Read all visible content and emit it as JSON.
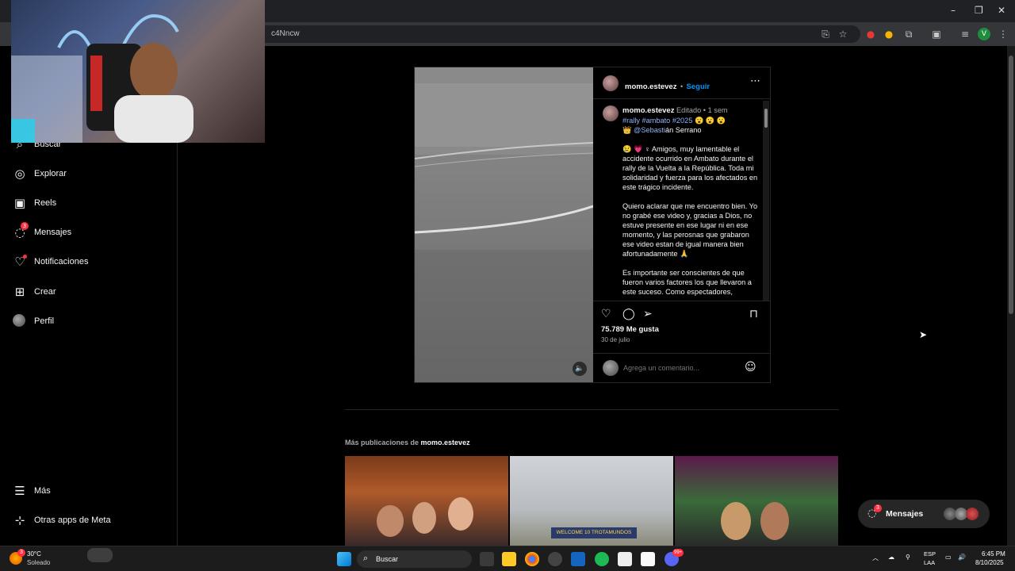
{
  "browser": {
    "url_fragment": "c4Nncw",
    "window_controls": [
      "–",
      "❐",
      "✕"
    ]
  },
  "sidebar": {
    "items": [
      {
        "label": "Buscar",
        "icon": "search-icon"
      },
      {
        "label": "Explorar",
        "icon": "compass-icon"
      },
      {
        "label": "Reels",
        "icon": "reels-icon"
      },
      {
        "label": "Mensajes",
        "icon": "messenger-icon",
        "badge": "3"
      },
      {
        "label": "Notificaciones",
        "icon": "heart-icon"
      },
      {
        "label": "Crear",
        "icon": "plus-square-icon"
      },
      {
        "label": "Perfil",
        "icon": "avatar-icon"
      },
      {
        "label": "Más",
        "icon": "menu-icon"
      },
      {
        "label": "Otras apps de Meta",
        "icon": "meta-apps-icon"
      }
    ]
  },
  "post": {
    "author": "momo.estevez",
    "follow_separator": "•",
    "follow_label": "Seguir",
    "caption_author": "momo.estevez",
    "edited_label": "Editado",
    "time_sep": "•",
    "time_ago": "1 sem",
    "hashtags": "#rally #ambato #2025",
    "hashtag_emojis": "😮 😮 😮",
    "mention_prefix": "👑",
    "mention": "@Sebasti",
    "mention_rest": "án Serrano",
    "para1": "😢 💗 ♀ Amigos, muy lamentable el accidente ocurrido en Ambato durante el rally de la Vuelta a la República. Toda mi solidaridad y fuerza para los afectados en este trágico incidente.",
    "para2": "Quiero aclarar que me encuentro bien. Yo no grabé ese video y, gracias a Dios, no estuve presente en ese lugar ni en ese momento, y las perosnas que grabaron ese video estan de igual manera bien afortunadamente 🙏",
    "para3": "Es importante ser conscientes de que fueron varios factores los que llevaron a este suceso. Como espectadores, debemos ubicarnos en zonas seguras y",
    "likes": "75.789 Me gusta",
    "date": "30 de julio",
    "comment_placeholder": "Agrega un comentario..."
  },
  "more": {
    "prefix": "Más publicaciones de",
    "author": "momo.estevez",
    "thumb2_sign": "WELCOME 10 TROTAMUNDOS"
  },
  "messages_pill": {
    "label": "Mensajes",
    "badge": "3"
  },
  "taskbar": {
    "weather_temp": "30°C",
    "weather_desc": "Soleado",
    "weather_badge": "3",
    "search_label": "Buscar",
    "lang_top": "ESP",
    "lang_bottom": "LAA",
    "time": "6:45 PM",
    "date": "8/10/2025",
    "discord_badge": "99+"
  }
}
